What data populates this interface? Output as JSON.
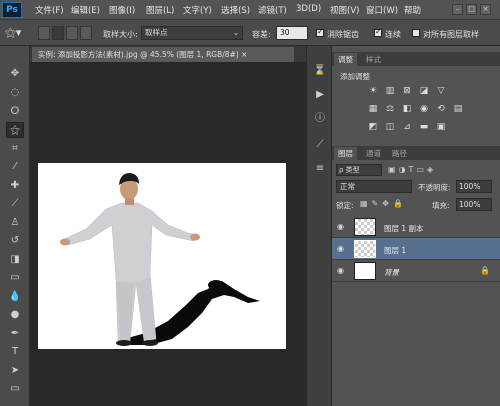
{
  "app": {
    "logo": "Ps"
  },
  "menubar": {
    "items": [
      "文件(F)",
      "编辑(E)",
      "图像(I)",
      "图层(L)",
      "文字(Y)",
      "选择(S)",
      "滤镜(T)",
      "3D(D)",
      "视图(V)",
      "窗口(W)",
      "帮助"
    ],
    "window_buttons": [
      "–",
      "□",
      "×"
    ]
  },
  "options": {
    "sample_size_label": "取样大小:",
    "sample_size_value": "取样点",
    "tolerance_label": "容差:",
    "tolerance_value": "30",
    "antialias_label": "消除锯齿",
    "antialias_checked": true,
    "contiguous_label": "连续",
    "contiguous_checked": true,
    "all_layers_label": "对所有图层取样",
    "all_layers_checked": false
  },
  "document": {
    "tab_title": "实例: 添加投影方法(素材).jpg @ 45.5% (图层 1, RGB/8#) ×"
  },
  "panels": {
    "adjust_tabs": [
      "调整",
      "样式"
    ],
    "adjust_subtitle": "添加调整",
    "layer_tabs": [
      "图层",
      "通道",
      "路径"
    ],
    "kind_filter": "ρ 类型",
    "blend_mode": "正常",
    "opacity_label": "不透明度:",
    "opacity_value": "100%",
    "lock_label": "锁定:",
    "fill_label": "填充:",
    "fill_value": "100%",
    "layers": [
      {
        "name": "图层 1 副本",
        "selected": false
      },
      {
        "name": "图层 1",
        "selected": true
      },
      {
        "name": "背景",
        "selected": false,
        "locked": true
      }
    ]
  }
}
